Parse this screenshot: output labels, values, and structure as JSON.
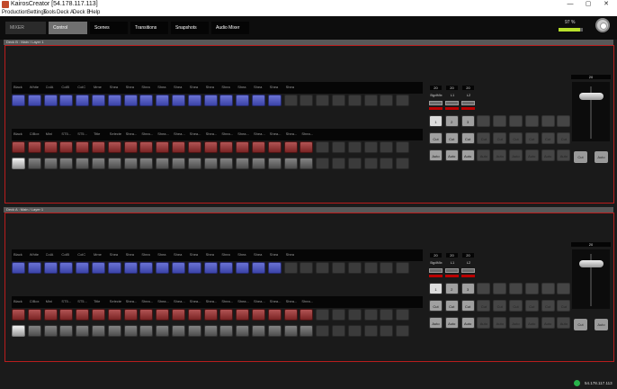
{
  "window": {
    "title": "KairosCreator [54.178.117.113]",
    "minimize": "—",
    "maximize": "▢",
    "close": "✕"
  },
  "menu": {
    "production": "Production",
    "settings": "Settings",
    "tools": "Tools",
    "decka": "Deck A",
    "deckb": "Deck B",
    "help": "Help"
  },
  "nav": {
    "mixer": "MIXER",
    "control": "Control",
    "scenes": "Scenes",
    "transitions": "Transitions",
    "snapshots": "Snapshots",
    "audio_mixer": "Audio Mixer"
  },
  "perf": {
    "label": "97 %",
    "value": 0.9
  },
  "decks": [
    {
      "header": "Deck B : Main / Layer 1",
      "row1_labels": [
        "Black",
        "White",
        "ColA",
        "ColB",
        "ColC",
        "Mme",
        "Shea",
        "Shea",
        "Shea",
        "Shea",
        "Shea",
        "Shea",
        "Shea",
        "Shea",
        "Shea",
        "Shea",
        "Shea",
        "Shea"
      ],
      "row2_labels": [
        "Black",
        "ClBox",
        "Mini",
        "ST5...",
        "ST5...",
        "Title",
        "Selecte",
        "Shea...",
        "Shea...",
        "Shea...",
        "Shea...",
        "Shea...",
        "Shea...",
        "Shea...",
        "Shea...",
        "Shea...",
        "Shea...",
        "Shea...",
        "Shea..."
      ],
      "ctrl": {
        "values": [
          "20",
          "20",
          "20"
        ],
        "names": [
          "BgdMix",
          "L1",
          "L2"
        ],
        "nums": [
          "1",
          "2",
          "3"
        ],
        "cut": "Cut",
        "auto": "Auto",
        "tbar_value": "20"
      }
    },
    {
      "header": "Deck A : Main / Layer 1",
      "row1_labels": [
        "Black",
        "White",
        "ColA",
        "ColB",
        "ColC",
        "Mme",
        "Shea",
        "Shea",
        "Shea",
        "Shea",
        "Shea",
        "Shea",
        "Shea",
        "Shea",
        "Shea",
        "Shea",
        "Shea",
        "Shea"
      ],
      "row2_labels": [
        "Black",
        "ClBox",
        "Mini",
        "ST5...",
        "ST5...",
        "Title",
        "Selecte",
        "Shea...",
        "Shea...",
        "Shea...",
        "Shea...",
        "Shea...",
        "Shea...",
        "Shea...",
        "Shea...",
        "Shea...",
        "Shea...",
        "Shea...",
        "Shea..."
      ],
      "ctrl": {
        "values": [
          "20",
          "20",
          "20"
        ],
        "names": [
          "BgdMix",
          "L1",
          "L2"
        ],
        "nums": [
          "1",
          "2",
          "3"
        ],
        "cut": "Cut",
        "auto": "Auto",
        "tbar_value": "20"
      }
    }
  ],
  "status": {
    "ip": "54.178.117.113"
  }
}
